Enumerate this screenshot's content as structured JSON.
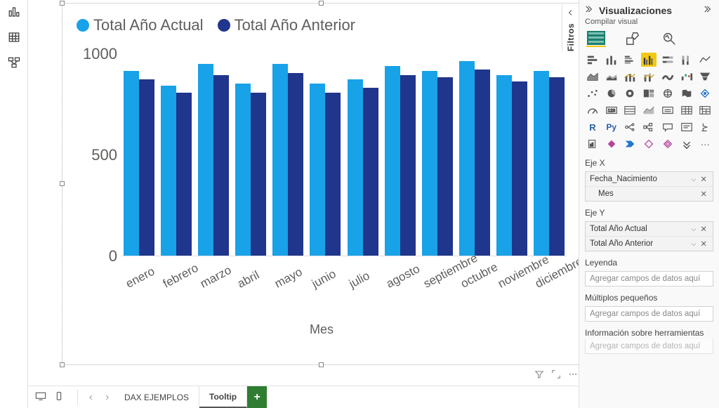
{
  "chart_data": {
    "type": "bar",
    "title": "",
    "xlabel": "Mes",
    "ylabel": "",
    "ylim": [
      0,
      1000
    ],
    "yticks": [
      0,
      500,
      1000
    ],
    "categories": [
      "enero",
      "febrero",
      "marzo",
      "abril",
      "mayo",
      "junio",
      "julio",
      "agosto",
      "septiembre",
      "octubre",
      "noviembre",
      "diciembre"
    ],
    "series": [
      {
        "name": "Total Año Actual",
        "color": "#18a2e8",
        "values": [
          850,
          780,
          880,
          790,
          880,
          790,
          810,
          870,
          850,
          895,
          830,
          850
        ]
      },
      {
        "name": "Total Año Anterior",
        "color": "#20358c",
        "values": [
          810,
          750,
          830,
          750,
          840,
          750,
          770,
          830,
          820,
          855,
          800,
          820
        ]
      }
    ]
  },
  "axis_title": "Mes",
  "yaxis_labels": {
    "top": "1000",
    "mid": "500",
    "bot": "0"
  },
  "filters": {
    "label": "Filtros"
  },
  "viz_pane": {
    "title": "Visualizaciones",
    "subtitle": "Compilar visual",
    "sections": {
      "x": "Eje X",
      "y": "Eje Y",
      "legend": "Leyenda",
      "small_mult": "Múltiplos pequeños",
      "tooltip": "Información sobre herramientas"
    },
    "x_field": "Fecha_Nacimiento",
    "x_sub": "Mes",
    "y_field_1": "Total Año Actual",
    "y_field_2": "Total Año Anterior",
    "legend_placeholder": "Agregar campos de datos aquí",
    "sm_placeholder": "Agregar campos de datos aquí",
    "tooltip_placeholder": "Agregar campos de datos aquí"
  },
  "viz_text": {
    "R": "R",
    "Py": "Py",
    "more": "···"
  },
  "footer": {
    "tab1": "DAX EJEMPLOS",
    "tab2": "Tooltip",
    "add": "+"
  }
}
